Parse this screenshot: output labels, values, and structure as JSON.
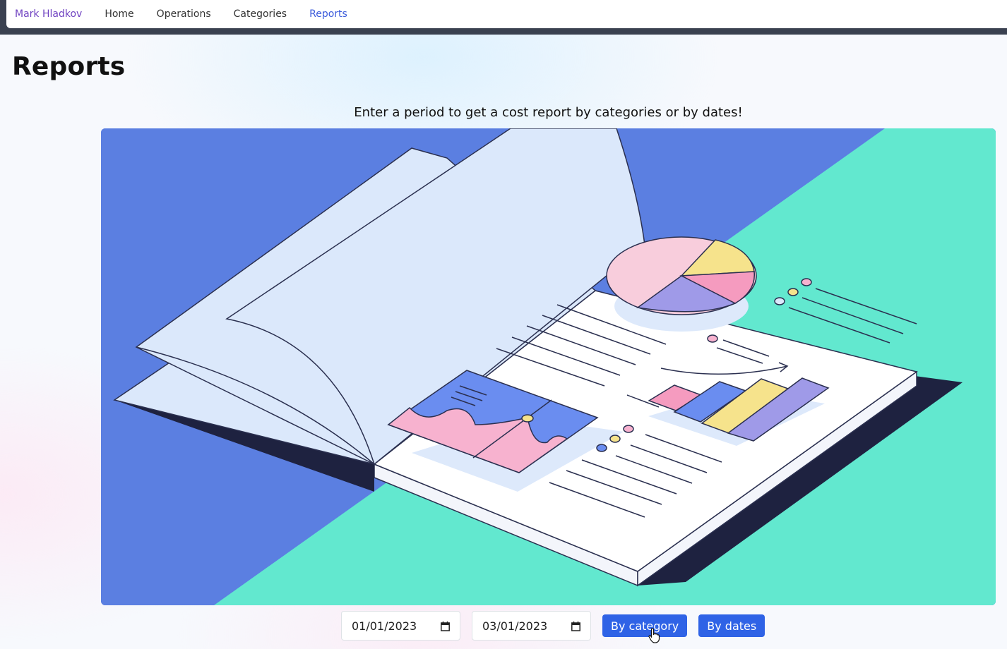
{
  "nav": {
    "brand": "Mark Hladkov",
    "items": [
      "Home",
      "Operations",
      "Categories",
      "Reports"
    ],
    "active": "Reports"
  },
  "page": {
    "title": "Reports",
    "subtitle": "Enter a period to get a cost report by categories or by dates!"
  },
  "form": {
    "start_date": "01/01/2023",
    "end_date": "03/01/2023",
    "by_category_label": "By category",
    "by_dates_label": "By dates"
  },
  "colors": {
    "nav_dark": "#3a4150",
    "brand": "#6f42c1",
    "active_link": "#3b5bdb",
    "button": "#2f63e6",
    "hero_blue": "#5b7fe1",
    "hero_green": "#62e8cf"
  },
  "icons": {
    "date_picker": "calendar-icon",
    "pointer": "hand-cursor-icon"
  }
}
